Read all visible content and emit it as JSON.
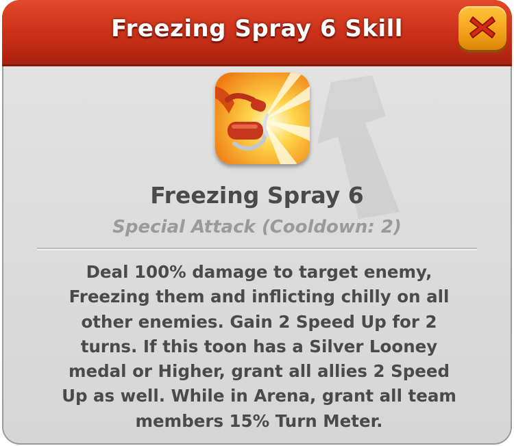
{
  "dialog": {
    "title": "Freezing Spray 6 Skill",
    "close_icon": "close-x-icon"
  },
  "skill": {
    "icon": "freezing-spray-skill-icon",
    "name": "Freezing Spray 6",
    "type": "Special Attack (Cooldown: 2)",
    "description": "Deal 100% damage to target enemy, Freezing them and inflicting chilly on all other enemies. Gain 2 Speed Up for 2 turns. If this toon has a Silver Looney medal or Higher, grant all allies 2 Speed Up as well. While in Arena, grant all team members 15% Turn Meter."
  },
  "colors": {
    "header": "#c93017",
    "panel": "#dcdcdc",
    "close_button": "#f3a11a",
    "close_x": "#d42a14",
    "text_primary": "#4a4a4a",
    "text_secondary": "#9a9a9a"
  }
}
